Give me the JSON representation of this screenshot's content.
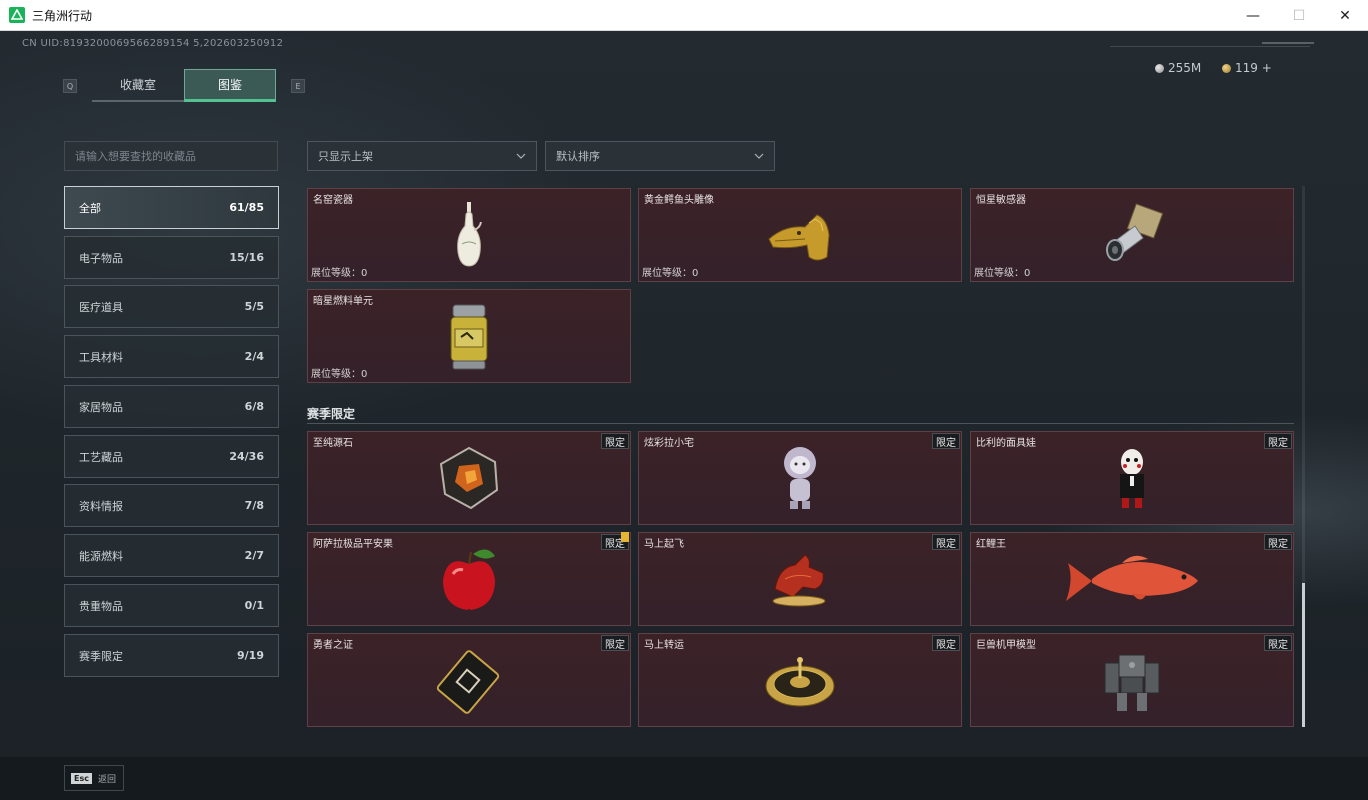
{
  "window": {
    "title": "三角洲行动",
    "controls": [
      "—",
      "☐",
      "✕"
    ]
  },
  "header": {
    "uid": "CN UID:8193200069566289154 5,202603250912",
    "currency_silver": "255M",
    "currency_gold": "119 +"
  },
  "tabs": {
    "left_key": "Q",
    "right_key": "E",
    "items": [
      {
        "label": "收藏室",
        "active": false
      },
      {
        "label": "图鉴",
        "active": true
      }
    ]
  },
  "search": {
    "placeholder": "请输入想要查找的收藏品"
  },
  "categories": [
    {
      "label": "全部",
      "count": "61/85",
      "active": true
    },
    {
      "label": "电子物品",
      "count": "15/16"
    },
    {
      "label": "医疗道具",
      "count": "5/5"
    },
    {
      "label": "工具材料",
      "count": "2/4"
    },
    {
      "label": "家居物品",
      "count": "6/8"
    },
    {
      "label": "工艺藏品",
      "count": "24/36"
    },
    {
      "label": "资料情报",
      "count": "7/8"
    },
    {
      "label": "能源燃料",
      "count": "2/7"
    },
    {
      "label": "贵重物品",
      "count": "0/1"
    },
    {
      "label": "赛季限定",
      "count": "9/19"
    }
  ],
  "filters": {
    "display": "只显示上架",
    "sort": "默认排序"
  },
  "items_top": [
    {
      "name": "名窑瓷器",
      "level": "展位等级：0",
      "art": "vase-icon"
    },
    {
      "name": "黄金鳄鱼头雕像",
      "level": "展位等级：0",
      "art": "gold-statue-icon"
    },
    {
      "name": "恒星敏感器",
      "level": "展位等级：0",
      "art": "sensor-icon"
    },
    {
      "name": "暗星燃料单元",
      "level": "展位等级：0",
      "art": "fuel-cell-icon"
    }
  ],
  "season_section": {
    "title": "赛季限定",
    "tag": "限定"
  },
  "items_season": [
    {
      "name": "至纯源石",
      "art": "crystal-icon"
    },
    {
      "name": "炫彩拉小宅",
      "art": "figure-icon"
    },
    {
      "name": "比利的面具娃",
      "art": "puppet-icon"
    },
    {
      "name": "阿萨拉极品平安果",
      "art": "apple-icon"
    },
    {
      "name": "马上起飞",
      "art": "horse-icon"
    },
    {
      "name": "红鲤王",
      "art": "carp-icon"
    },
    {
      "name": "勇者之证",
      "art": "card-icon"
    },
    {
      "name": "马上转运",
      "art": "compass-icon"
    },
    {
      "name": "巨兽机甲模型",
      "art": "mech-icon"
    }
  ],
  "footer": {
    "esc_key": "Esc",
    "esc_label": "返回"
  },
  "colors": {
    "accent": "#52c28f",
    "card_bg": "#3b2227"
  }
}
